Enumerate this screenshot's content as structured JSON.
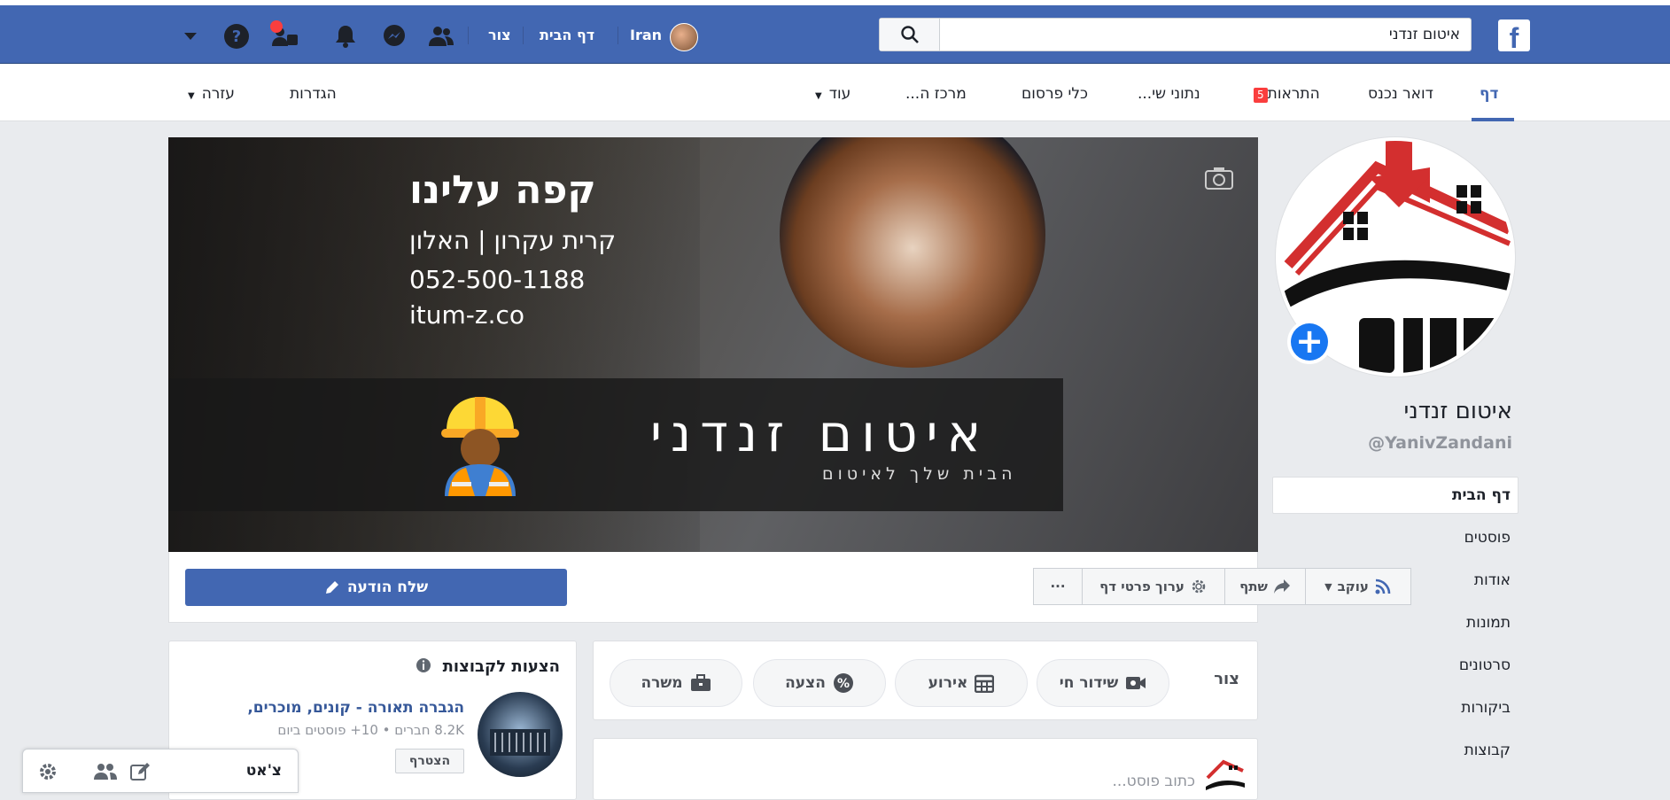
{
  "topbar": {
    "logo": "f",
    "search_value": "איטום זנדני",
    "user_name": "Iran",
    "home_link": "דף הבית",
    "create_link": "צור"
  },
  "nav": {
    "page": "דף",
    "inbox": "דואר נכנס",
    "notifications": "התראות",
    "notifications_count": "5",
    "insights": "נתוני שי...",
    "publishing_tools": "כלי פרסום",
    "ad_center": "מרכז ה...",
    "more": "עוד",
    "settings": "הגדרות",
    "help": "עזרה"
  },
  "cover": {
    "headline": "קפה עלינו",
    "location": "קרית עקרון | האלון",
    "phone": "052-500-1188",
    "website": "itum-z.co",
    "brand_title": "איטום זנדני",
    "brand_sub": "הבית שלך לאיטום"
  },
  "actions": {
    "send_message": "שלח הודעה",
    "follow": "עוקב",
    "share": "שתף",
    "edit_page": "ערוך פרטי דף",
    "more": "···"
  },
  "sidebar": {
    "page_name": "איטום זנדני",
    "handle": "@YanivZandani",
    "items": [
      "דף הבית",
      "פוסטים",
      "אודות",
      "תמונות",
      "סרטונים",
      "ביקורות",
      "קבוצות"
    ]
  },
  "create": {
    "label": "צור",
    "live": "שידור חי",
    "event": "אירוע",
    "offer": "הצעה",
    "job": "משרה",
    "write_post": "כתוב פוסט..."
  },
  "groups": {
    "title": "הצעות לקבוצות",
    "group_name": "הגברה תאורה - קונים, מוכרים,",
    "group_meta": "8.2K חברים • 10+ פוסטים ביום",
    "join": "הצטרף"
  },
  "chat": {
    "label": "צ'אט"
  },
  "colors": {
    "brand_blue": "#4267b2",
    "notification_red": "#fa3e3e"
  }
}
